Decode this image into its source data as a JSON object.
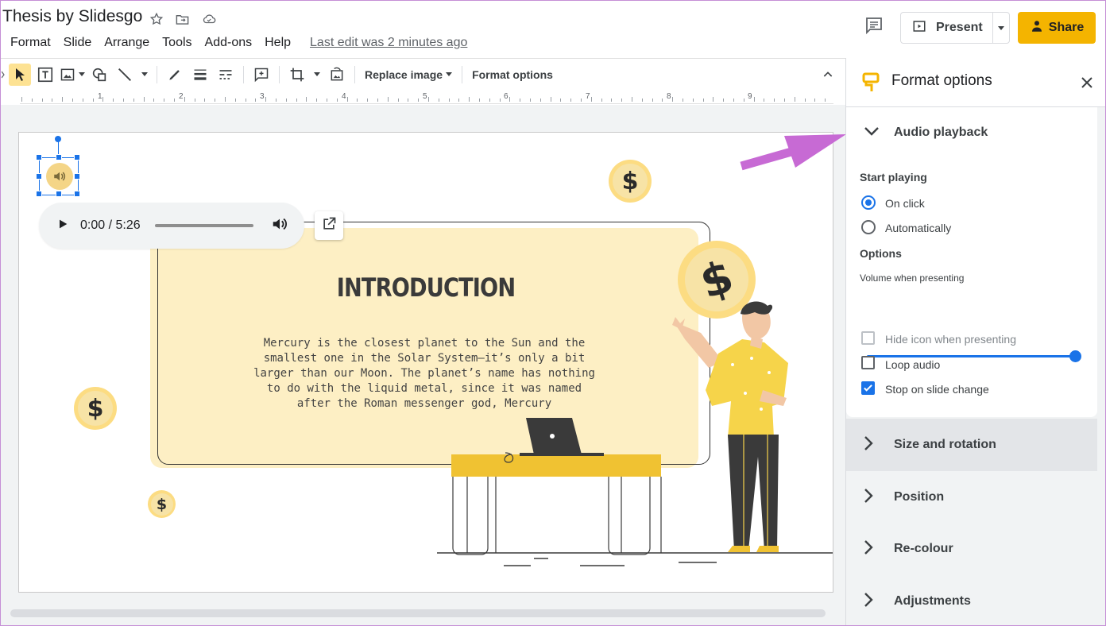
{
  "window": {
    "doc_title": "Thesis by Slidesgo",
    "last_edit": "Last edit was 2 minutes ago"
  },
  "menubar": {
    "items": [
      {
        "label": "Format"
      },
      {
        "label": "Slide"
      },
      {
        "label": "Arrange"
      },
      {
        "label": "Tools"
      },
      {
        "label": "Add-ons"
      },
      {
        "label": "Help"
      }
    ]
  },
  "header": {
    "present_label": "Present",
    "share_label": "Share",
    "accent_color": "#f4b400"
  },
  "toolbar": {
    "replace_image_label": "Replace image",
    "format_options_label": "Format options"
  },
  "ruler": {
    "numbers": [
      "1",
      "2",
      "3",
      "4",
      "5",
      "6",
      "7",
      "8",
      "9"
    ]
  },
  "slide": {
    "title": "INTRODUCTION",
    "body": "Mercury is the closest planet to the Sun and the smallest one in the Solar System—it’s only a bit larger than our Moon. The planet’s name has nothing to do with the liquid metal, since it was named after the Roman messenger god, Mercury",
    "coin_symbol": "$"
  },
  "player": {
    "time": "0:00 / 5:26",
    "progress_fraction": 0
  },
  "panel": {
    "title": "Format options",
    "audio_section": {
      "label": "Audio playback",
      "start_playing_label": "Start playing",
      "options": [
        {
          "label": "On click",
          "selected": true
        },
        {
          "label": "Automatically",
          "selected": false
        }
      ],
      "options_label": "Options",
      "volume_label": "Volume when presenting",
      "volume_fraction": 1.0,
      "checkboxes": [
        {
          "label": "Hide icon when presenting",
          "checked": false,
          "disabled": true
        },
        {
          "label": "Loop audio",
          "checked": false,
          "disabled": false
        },
        {
          "label": "Stop on slide change",
          "checked": true,
          "disabled": false
        }
      ]
    },
    "collapsed_sections": [
      {
        "label": "Size and rotation"
      },
      {
        "label": "Position"
      },
      {
        "label": "Re-colour"
      },
      {
        "label": "Adjustments"
      }
    ]
  }
}
